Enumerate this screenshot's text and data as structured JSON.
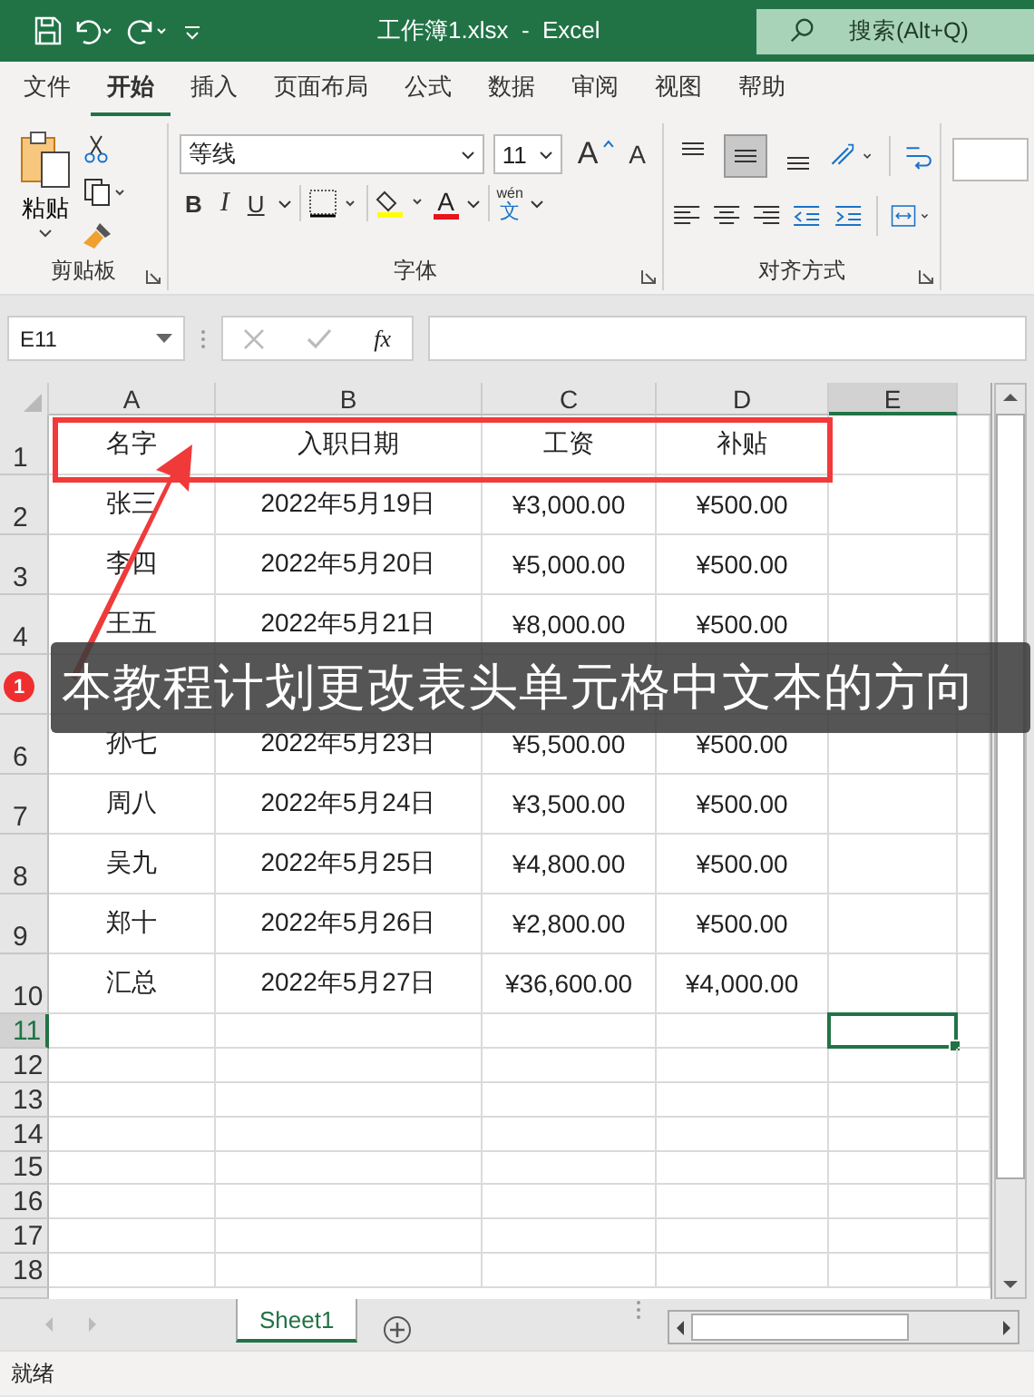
{
  "title_bar": {
    "title": "工作簿1.xlsx  -  Excel",
    "search": {
      "placeholder": "搜索(Alt+Q)"
    }
  },
  "ribbon_tabs": [
    {
      "label": "文件",
      "selected": false
    },
    {
      "label": "开始",
      "selected": true
    },
    {
      "label": "插入",
      "selected": false
    },
    {
      "label": "页面布局",
      "selected": false
    },
    {
      "label": "公式",
      "selected": false
    },
    {
      "label": "数据",
      "selected": false
    },
    {
      "label": "审阅",
      "selected": false
    },
    {
      "label": "视图",
      "selected": false
    },
    {
      "label": "帮助",
      "selected": false
    }
  ],
  "ribbon": {
    "clipboard": {
      "paste": "粘贴",
      "group_label": "剪贴板"
    },
    "font": {
      "font_name": "等线",
      "font_size": "11",
      "grow": "A",
      "shrink": "A",
      "bold": "B",
      "italic": "I",
      "underline": "U",
      "font_color": "A",
      "phonetic_top": "wén",
      "phonetic_bottom": "文",
      "group_label": "字体"
    },
    "alignment": {
      "vertical": [
        {
          "kind": "top",
          "selected": false
        },
        {
          "kind": "middle",
          "selected": true
        },
        {
          "kind": "bottom",
          "selected": false
        }
      ],
      "group_label": "对齐方式"
    }
  },
  "formula_bar": {
    "name_box": "E11",
    "fx": "fx"
  },
  "columns": [
    {
      "label": "A",
      "selected": false
    },
    {
      "label": "B",
      "selected": false
    },
    {
      "label": "C",
      "selected": false
    },
    {
      "label": "D",
      "selected": false
    },
    {
      "label": "E",
      "selected": true
    }
  ],
  "rows": [
    {
      "number": "1",
      "selected": false,
      "cells": [
        "名字",
        "入职日期",
        "工资",
        "补贴"
      ]
    },
    {
      "number": "2",
      "selected": false,
      "cells": [
        "张三",
        "2022年5月19日",
        "¥3,000.00",
        "¥500.00"
      ]
    },
    {
      "number": "3",
      "selected": false,
      "cells": [
        "李四",
        "2022年5月20日",
        "¥5,000.00",
        "¥500.00"
      ]
    },
    {
      "number": "4",
      "selected": false,
      "cells": [
        "王五",
        "2022年5月21日",
        "¥8,000.00",
        "¥500.00"
      ]
    },
    {
      "selected": false
    },
    {
      "number": "6",
      "selected": false,
      "cells": [
        "孙七",
        "2022年5月23日",
        "¥5,500.00",
        "¥500.00"
      ]
    },
    {
      "number": "7",
      "selected": false,
      "cells": [
        "周八",
        "2022年5月24日",
        "¥3,500.00",
        "¥500.00"
      ]
    },
    {
      "number": "8",
      "selected": false,
      "cells": [
        "吴九",
        "2022年5月25日",
        "¥4,800.00",
        "¥500.00"
      ]
    },
    {
      "number": "9",
      "selected": false,
      "cells": [
        "郑十",
        "2022年5月26日",
        "¥2,800.00",
        "¥500.00"
      ]
    },
    {
      "number": "10",
      "selected": false,
      "cells": [
        "汇总",
        "2022年5月27日",
        "¥36,600.00",
        "¥4,000.00"
      ]
    },
    {
      "number": "11",
      "selected": true
    },
    {
      "number": "12",
      "selected": false
    },
    {
      "number": "13",
      "selected": false
    },
    {
      "number": "14",
      "selected": false
    },
    {
      "number": "15",
      "selected": false
    },
    {
      "number": "16",
      "selected": false
    },
    {
      "number": "17",
      "selected": false
    },
    {
      "number": "18",
      "selected": false
    }
  ],
  "sheet_tabs": [
    {
      "label": "Sheet1",
      "selected": true
    }
  ],
  "status_bar": {
    "text": "就绪"
  },
  "annotation": {
    "badge": "1",
    "text": "本教程计划更改表头单元格中文本的方向",
    "highlight_header": true,
    "arrow": true
  }
}
